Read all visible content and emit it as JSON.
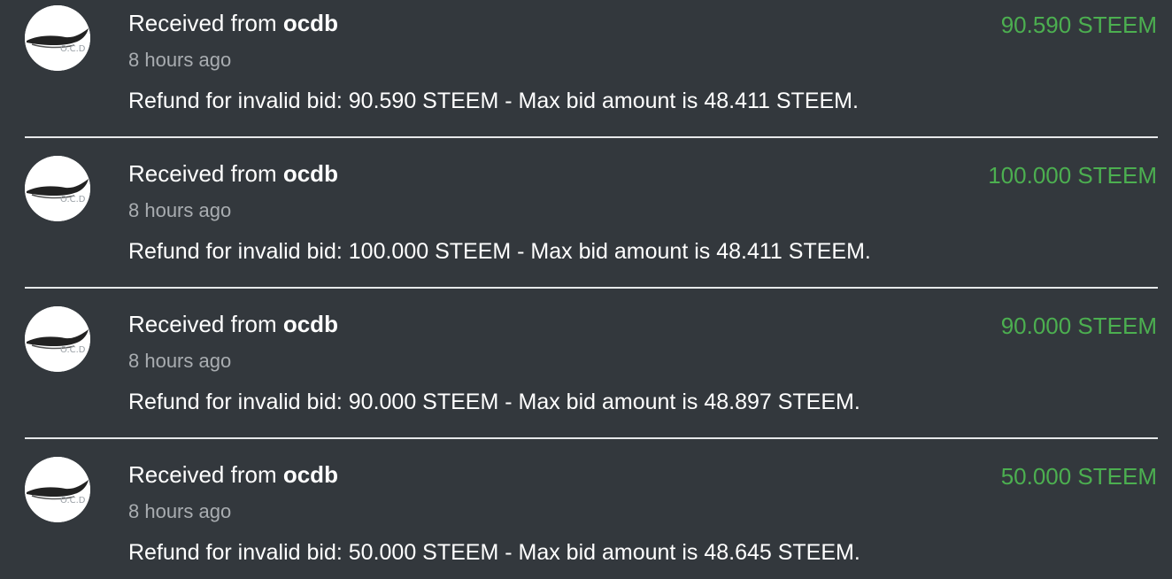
{
  "transactions": [
    {
      "title_prefix": "Received from ",
      "sender": "ocdb",
      "time": "8 hours ago",
      "memo": "Refund for invalid bid: 90.590 STEEM - Max bid amount is 48.411 STEEM.",
      "amount": "90.590 STEEM",
      "avatar_text": "O.C.D"
    },
    {
      "title_prefix": "Received from ",
      "sender": "ocdb",
      "time": "8 hours ago",
      "memo": "Refund for invalid bid: 100.000 STEEM - Max bid amount is 48.411 STEEM.",
      "amount": "100.000 STEEM",
      "avatar_text": "O.C.D"
    },
    {
      "title_prefix": "Received from ",
      "sender": "ocdb",
      "time": "8 hours ago",
      "memo": "Refund for invalid bid: 90.000 STEEM - Max bid amount is 48.897 STEEM.",
      "amount": "90.000 STEEM",
      "avatar_text": "O.C.D"
    },
    {
      "title_prefix": "Received from ",
      "sender": "ocdb",
      "time": "8 hours ago",
      "memo": "Refund for invalid bid: 50.000 STEEM - Max bid amount is 48.645 STEEM.",
      "amount": "50.000 STEEM",
      "avatar_text": "O.C.D"
    }
  ],
  "colors": {
    "background": "#33383d",
    "amount": "#4caf50",
    "muted": "#a9adb1",
    "divider": "#e6e8ea"
  },
  "icons": {
    "avatar": "ocdb-whale-logo"
  }
}
